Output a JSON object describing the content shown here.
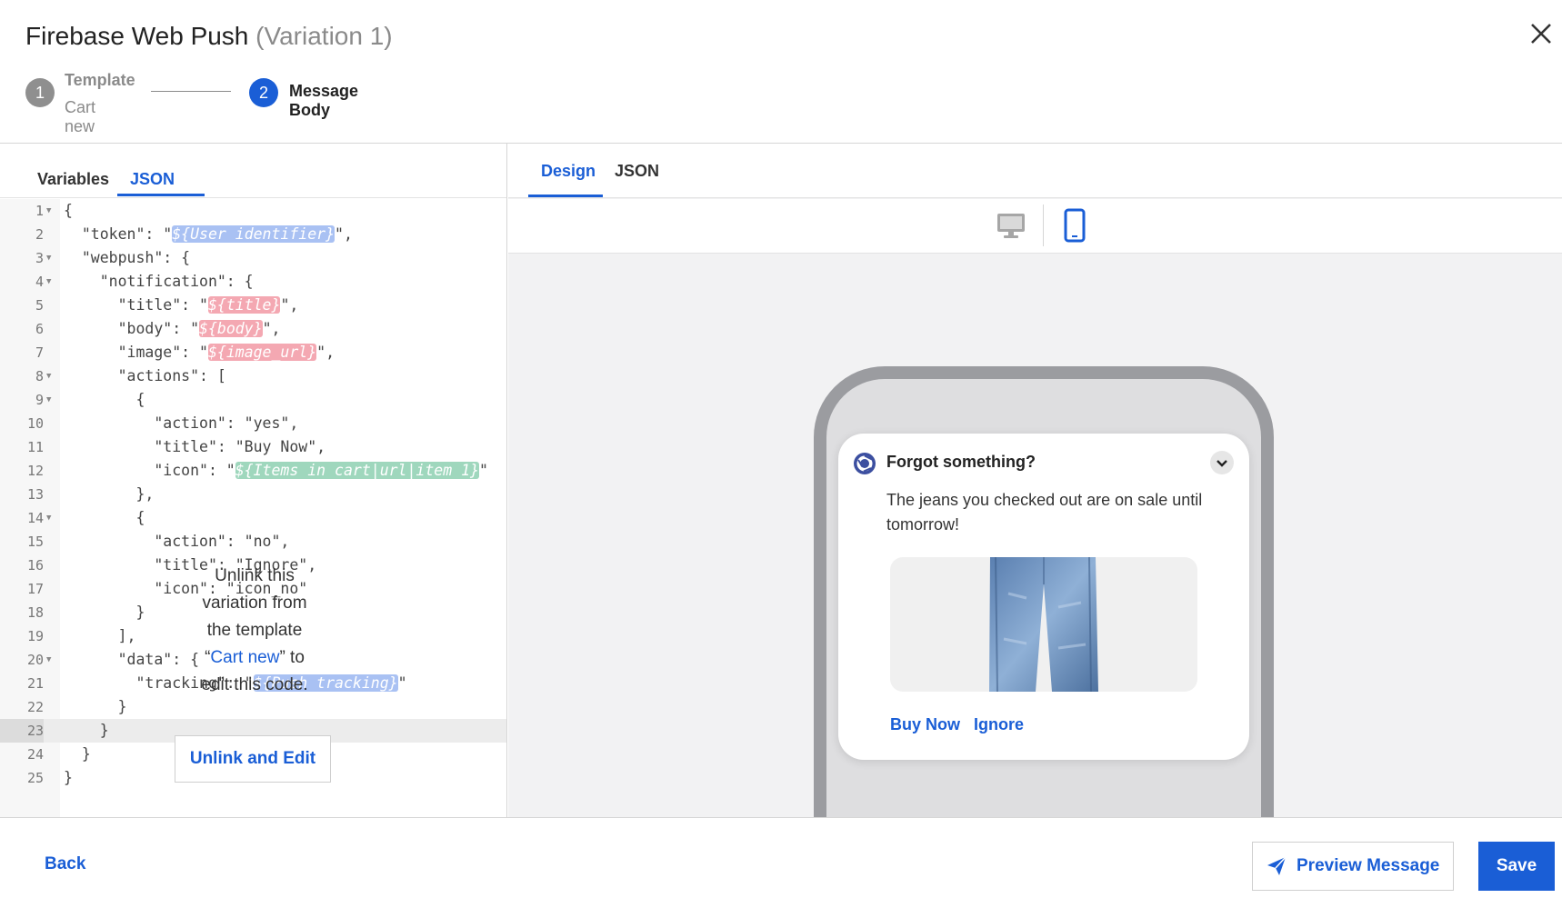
{
  "header": {
    "title": "Firebase Web Push",
    "title_suffix": "(Variation 1)",
    "close_icon": "close-icon",
    "steps": [
      {
        "number": "1",
        "label": "Template",
        "sublabel": "Cart new",
        "state": "completed"
      },
      {
        "number": "2",
        "label": "Message Body",
        "state": "active"
      }
    ]
  },
  "left_panel": {
    "tabs": [
      {
        "label": "Variables",
        "active": false
      },
      {
        "label": "JSON",
        "active": true
      }
    ],
    "code_lines": [
      {
        "n": "1",
        "fold": true,
        "text": "{"
      },
      {
        "n": "2",
        "fold": false,
        "pre": "  \"token\": \"",
        "var": "${User identifier}",
        "var_color": "blue",
        "post": "\","
      },
      {
        "n": "3",
        "fold": true,
        "text": "  \"webpush\": {"
      },
      {
        "n": "4",
        "fold": true,
        "text": "    \"notification\": {"
      },
      {
        "n": "5",
        "fold": false,
        "pre": "      \"title\": \"",
        "var": "${title}",
        "var_color": "pink",
        "post": "\","
      },
      {
        "n": "6",
        "fold": false,
        "pre": "      \"body\": \"",
        "var": "${body}",
        "var_color": "pink",
        "post": "\","
      },
      {
        "n": "7",
        "fold": false,
        "pre": "      \"image\": \"",
        "var": "${image_url}",
        "var_color": "pink",
        "post": "\","
      },
      {
        "n": "8",
        "fold": true,
        "text": "      \"actions\": ["
      },
      {
        "n": "9",
        "fold": true,
        "text": "        {"
      },
      {
        "n": "10",
        "fold": false,
        "text": "          \"action\": \"yes\","
      },
      {
        "n": "11",
        "fold": false,
        "text": "          \"title\": \"Buy Now\","
      },
      {
        "n": "12",
        "fold": false,
        "pre": "          \"icon\": \"",
        "var": "${Items in cart|url|item 1}",
        "var_color": "green",
        "post": "\""
      },
      {
        "n": "13",
        "fold": false,
        "text": "        },"
      },
      {
        "n": "14",
        "fold": true,
        "text": "        {"
      },
      {
        "n": "15",
        "fold": false,
        "text": "          \"action\": \"no\","
      },
      {
        "n": "16",
        "fold": false,
        "text": "          \"title\": \"Ignore\","
      },
      {
        "n": "17",
        "fold": false,
        "text": "          \"icon\": \"icon_no\""
      },
      {
        "n": "18",
        "fold": false,
        "text": "        }"
      },
      {
        "n": "19",
        "fold": false,
        "text": "      ],"
      },
      {
        "n": "20",
        "fold": true,
        "text": "      \"data\": {"
      },
      {
        "n": "21",
        "fold": false,
        "pre": "        \"tracking\": \"",
        "var": "${Push tracking}",
        "var_color": "blue",
        "post": "\""
      },
      {
        "n": "22",
        "fold": false,
        "text": "      }"
      },
      {
        "n": "23",
        "fold": false,
        "text": "    }",
        "active": true
      },
      {
        "n": "24",
        "fold": false,
        "text": "  }"
      },
      {
        "n": "25",
        "fold": false,
        "text": "}"
      }
    ],
    "overlay": {
      "text_before": "Unlink this variation from the template “",
      "template_name": "Cart new",
      "text_after": "” to edit this code.",
      "button_label": "Unlink and Edit"
    }
  },
  "right_panel": {
    "tabs": [
      {
        "label": "Design",
        "active": true
      },
      {
        "label": "JSON",
        "active": false
      }
    ],
    "device_toggle": {
      "options": [
        "desktop-icon",
        "mobile-icon"
      ],
      "selected": "mobile"
    },
    "notification": {
      "browser_icon": "chrome-icon",
      "title": "Forgot something?",
      "body": "The jeans you checked out are on sale until tomorrow!",
      "image": "jeans-image",
      "actions": [
        "Buy Now",
        "Ignore"
      ]
    }
  },
  "footer": {
    "back_label": "Back",
    "preview_label": "Preview Message",
    "preview_icon": "send-icon",
    "save_label": "Save"
  },
  "colors": {
    "accent": "#1a5ed6",
    "var_blue": "#a9c1f3",
    "var_pink": "#f4a8b2",
    "var_green": "#9fd7bd",
    "phone_frame": "#9b9ca0"
  }
}
